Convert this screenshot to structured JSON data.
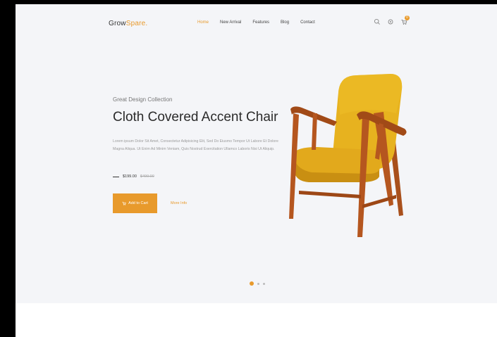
{
  "header": {
    "logo_main": "Grow",
    "logo_accent": "Spare.",
    "nav": [
      {
        "label": "Home",
        "active": true
      },
      {
        "label": "New Arrival",
        "active": false
      },
      {
        "label": "Features",
        "active": false
      },
      {
        "label": "Blog",
        "active": false
      },
      {
        "label": "Contact",
        "active": false
      }
    ],
    "icons": [
      "search-icon",
      "settings-icon",
      "cart-icon"
    ],
    "cart_count": "0"
  },
  "hero": {
    "eyebrow": "Great Design Collection",
    "title": "Cloth Covered Accent Chair",
    "description": "Lorem ipsum Dolor Sit Amet, Consectetur Adipisicing Elit, Sed Do Eiusmo Tempor Ut Labore Et Dolore Magna Aliqua. Ut Enim Ad Minim Veniam, Quis Nostrud Exercitation Ullamco Laboris Nisi Ut Aliquip.",
    "price": "$199.00",
    "old_price": "$499.00",
    "add_to_cart": "Add to Cart",
    "more_info": "More Info"
  },
  "slider": {
    "active_index": 0,
    "count": 3
  },
  "colors": {
    "accent": "#e89a2c",
    "hero_bg": "#f4f5f8",
    "chair_fabric": "#e7b21f",
    "chair_wood": "#b5561f"
  }
}
